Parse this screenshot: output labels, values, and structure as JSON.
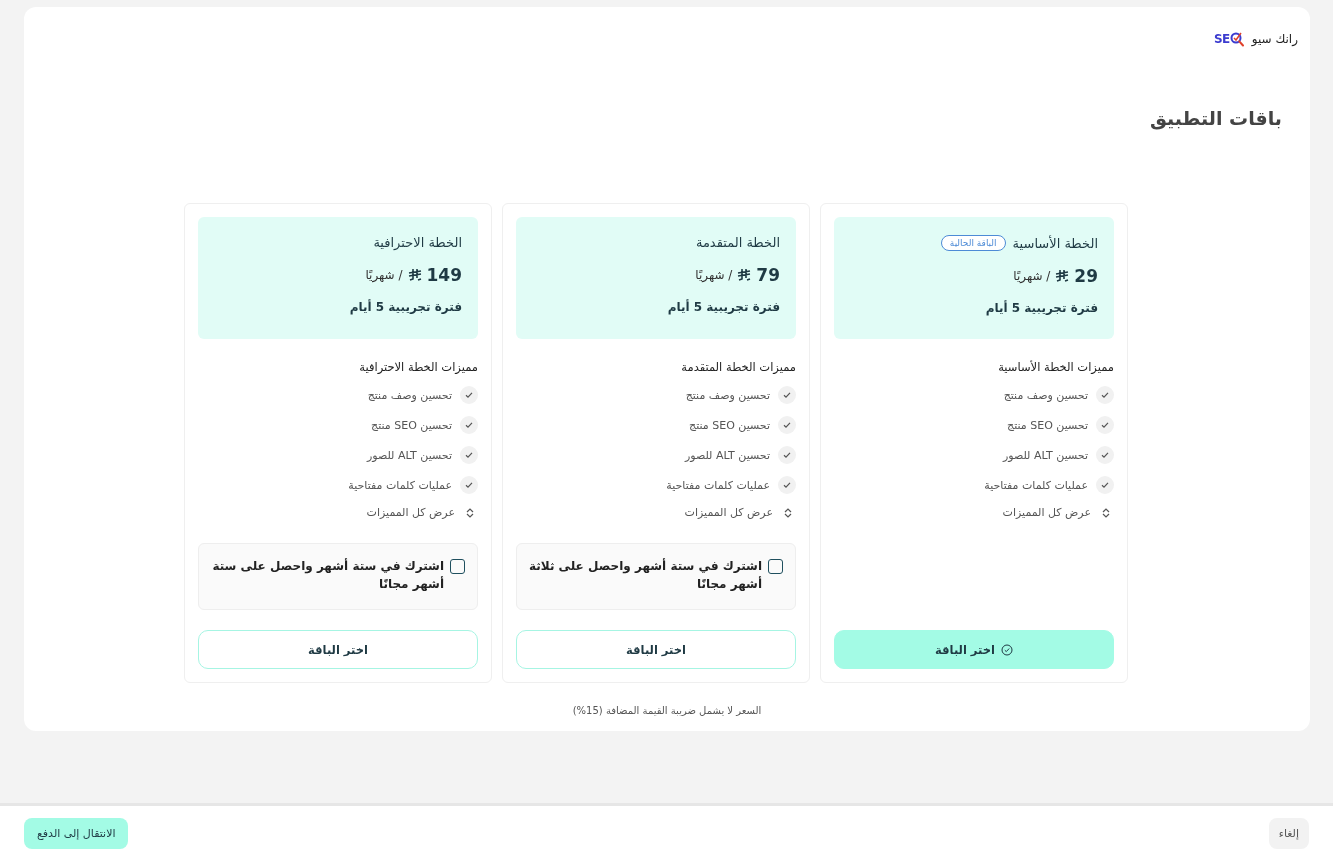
{
  "app": {
    "brand_mark": "SE",
    "name": "رانك سيو"
  },
  "page": {
    "title": "باقات التطبيق"
  },
  "plans": [
    {
      "name": "الخطة الأساسية",
      "badge": "الباقة الحالية",
      "price": "29",
      "period": "/ شهريًا",
      "trial": "فترة تجريبية 5 أيام",
      "features_title": "مميزات الخطة الأساسية",
      "features": [
        "تحسين وصف منتج",
        "تحسين SEO منتج",
        "تحسين ALT للصور",
        "عمليات كلمات مفتاحية"
      ],
      "show_all": "عرض كل المميزات",
      "button": "اختر الباقة",
      "selected": true
    },
    {
      "name": "الخطة المتقدمة",
      "price": "79",
      "period": "/ شهريًا",
      "trial": "فترة تجريبية 5 أيام",
      "features_title": "مميزات الخطة المتقدمة",
      "features": [
        "تحسين وصف منتج",
        "تحسين SEO منتج",
        "تحسين ALT للصور",
        "عمليات كلمات مفتاحية"
      ],
      "show_all": "عرض كل المميزات",
      "offer": {
        "label": "اشترك في ستة أشهر واحصل على ثلاثة أشهر مجانًا",
        "checked": false
      },
      "button": "اختر الباقة",
      "selected": false
    },
    {
      "name": "الخطة الاحترافية",
      "price": "149",
      "period": "/ شهريًا",
      "trial": "فترة تجريبية 5 أيام",
      "features_title": "مميزات الخطة الاحترافية",
      "features": [
        "تحسين وصف منتج",
        "تحسين SEO منتج",
        "تحسين ALT للصور",
        "عمليات كلمات مفتاحية"
      ],
      "show_all": "عرض كل المميزات",
      "offer": {
        "label": "اشترك في ستة أشهر واحصل على ستة أشهر مجانًا",
        "checked": false
      },
      "button": "اختر الباقة",
      "selected": false
    }
  ],
  "vat_note": "السعر لا يشمل ضريبة القيمة المضافة (15%)",
  "footer": {
    "cancel": "إلغاء",
    "proceed": "الانتقال إلى الدفع"
  }
}
